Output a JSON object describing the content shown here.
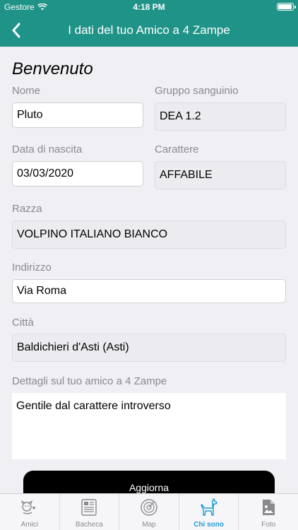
{
  "status": {
    "carrier": "Gestore",
    "time": "4:18 PM",
    "battery_level": 0.95
  },
  "nav": {
    "title": "I dati del tuo Amico a 4 Zampe"
  },
  "form": {
    "welcome": "Benvenuto",
    "name_label": "Nome",
    "name_value": "Pluto",
    "blood_label": "Gruppo sanguinio",
    "blood_value": "DEA 1.2",
    "birth_label": "Data di nascita",
    "birth_value": "03/03/2020",
    "character_label": "Carattere",
    "character_value": "AFFABILE",
    "breed_label": "Razza",
    "breed_value": "VOLPINO ITALIANO BIANCO",
    "address_label": "Indirizzo",
    "address_value": "Via Roma",
    "city_label": "Città",
    "city_value": "Baldichieri d'Asti (Asti)",
    "details_label": "Dettagli sul tuo amico a 4 Zampe",
    "details_value": "Gentile dal carattere introverso",
    "update_button": "Aggiorna"
  },
  "tabs": [
    {
      "label": "Amici",
      "icon": "friends-icon",
      "active": false
    },
    {
      "label": "Bacheca",
      "icon": "board-icon",
      "active": false
    },
    {
      "label": "Map",
      "icon": "radar-icon",
      "active": false
    },
    {
      "label": "Chi sono",
      "icon": "dog-icon",
      "active": true
    },
    {
      "label": "Foto",
      "icon": "photo-file-icon",
      "active": false
    }
  ],
  "colors": {
    "accent": "#1f9387",
    "tab_active": "#1f9cd8",
    "tab_inactive": "#8a8a8e"
  }
}
